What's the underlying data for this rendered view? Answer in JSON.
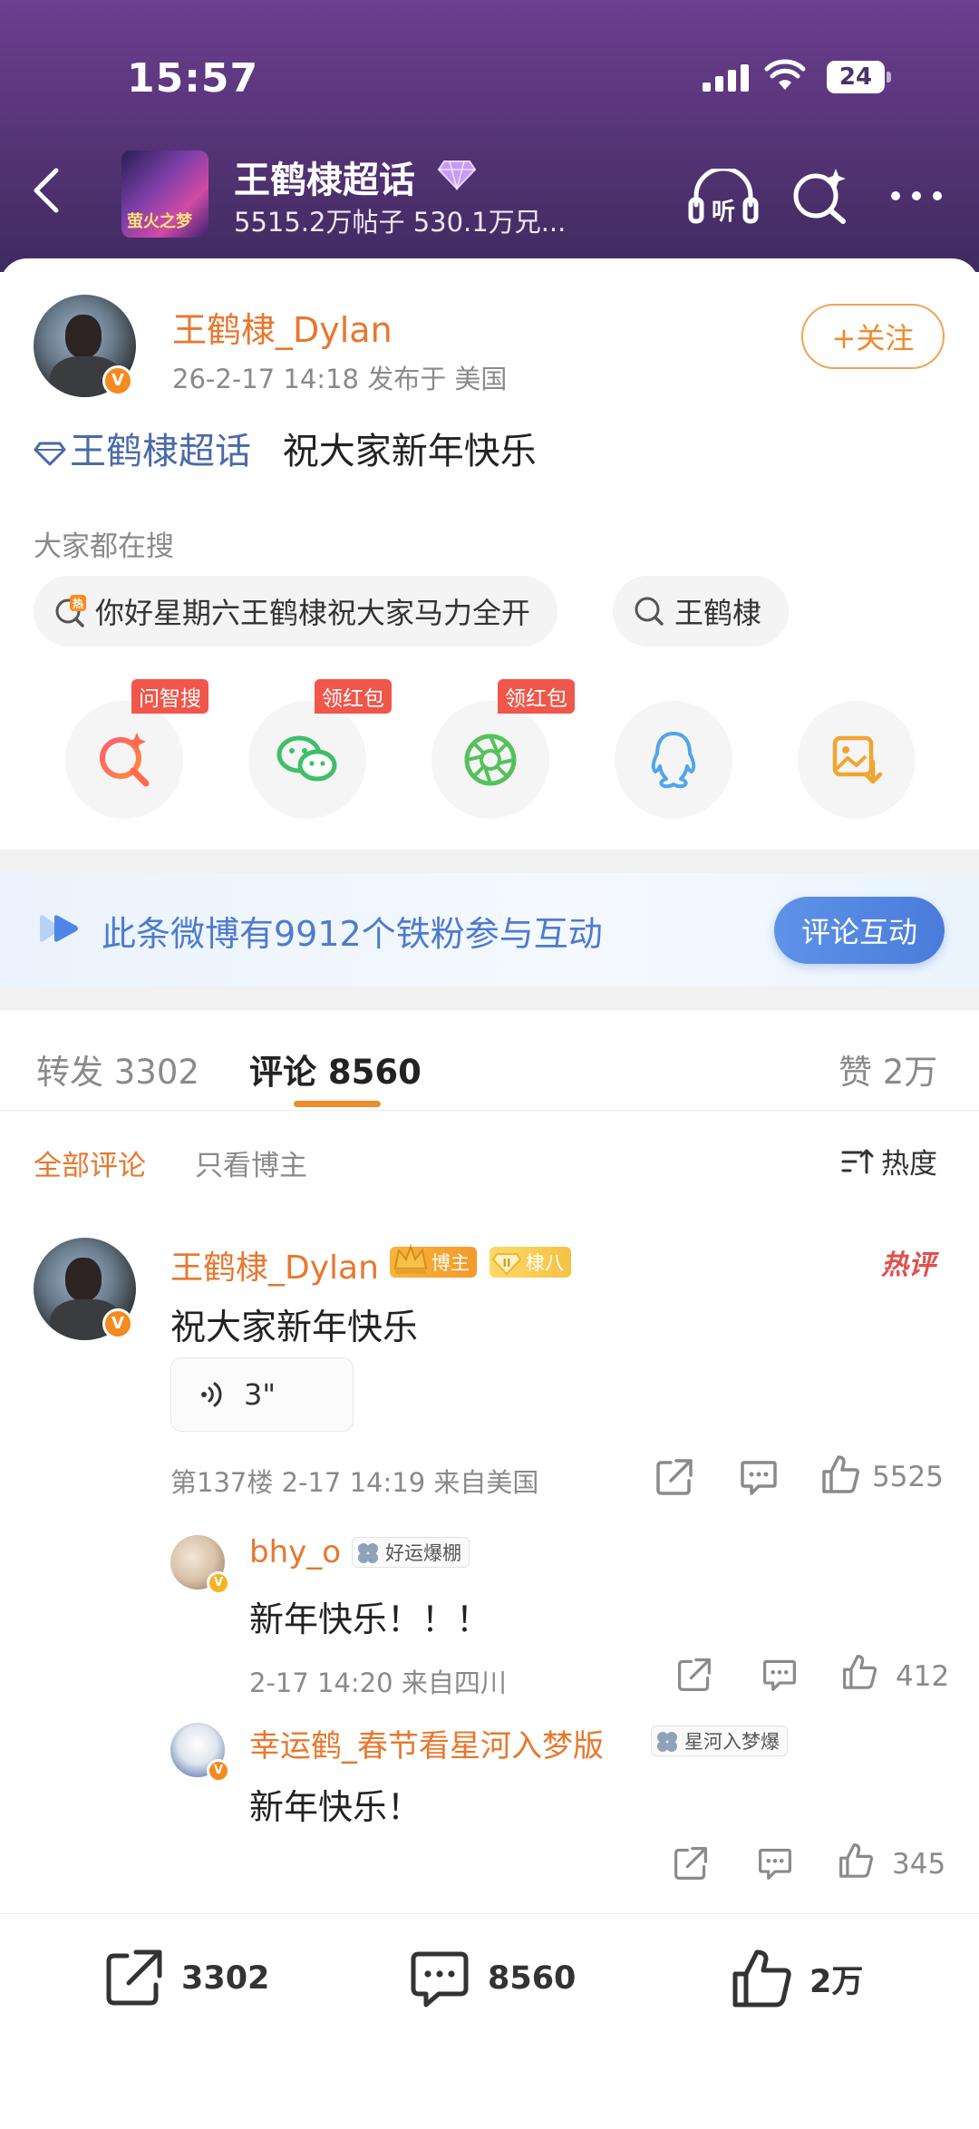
{
  "status_bar": {
    "time": "15:57",
    "battery": "24"
  },
  "nav": {
    "topic_title": "王鹤棣超话",
    "topic_subtitle": "5515.2万帖子 530.1万兄...",
    "thumb_text": "萤火之梦"
  },
  "post": {
    "author": "王鹤棣_Dylan",
    "meta": "26-2-17 14:18  发布于 美国",
    "follow_label": "+关注",
    "topic_link": "王鹤棣超话",
    "text": "祝大家新年快乐"
  },
  "search": {
    "label": "大家都在搜",
    "chips": [
      "你好星期六王鹤棣祝大家马力全开",
      "王鹤棣"
    ]
  },
  "share_row": {
    "items": [
      {
        "name": "ai-search",
        "tag": "问智搜"
      },
      {
        "name": "wechat",
        "tag": "领红包"
      },
      {
        "name": "moments",
        "tag": "领红包"
      },
      {
        "name": "qq",
        "tag": ""
      },
      {
        "name": "save-image",
        "tag": ""
      }
    ]
  },
  "fans_banner": {
    "text": "此条微博有9912个铁粉参与互动",
    "button": "评论互动"
  },
  "tabs": {
    "repost": "转发 3302",
    "comment": "评论 8560",
    "like": "赞 2万"
  },
  "filters": {
    "all": "全部评论",
    "author_only": "只看博主",
    "sort": "热度"
  },
  "comments": [
    {
      "name": "王鹤棣_Dylan",
      "badge_blogger": "博主",
      "badge_fan": "棣八",
      "hot_tag": "热评",
      "text": "祝大家新年快乐",
      "voice": "3\"",
      "meta": "第137楼  2-17 14:19  来自美国",
      "likes": "5525"
    }
  ],
  "replies": [
    {
      "name": "bhy_o",
      "badge": "好运爆棚",
      "text": "新年快乐！！！",
      "meta": "2-17 14:20  来自四川",
      "likes": "412"
    },
    {
      "name": "幸运鹤_春节看星河入梦版",
      "badge": "星河入梦爆",
      "text": "新年快乐！",
      "likes": "345"
    }
  ],
  "bottom_bar": {
    "repost": "3302",
    "comment": "8560",
    "like": "2万"
  },
  "colors": {
    "accent_orange": "#e8772e",
    "link_blue": "#4a6aa8",
    "banner_blue": "#4e7ad0",
    "header_purple": "#59357a"
  }
}
